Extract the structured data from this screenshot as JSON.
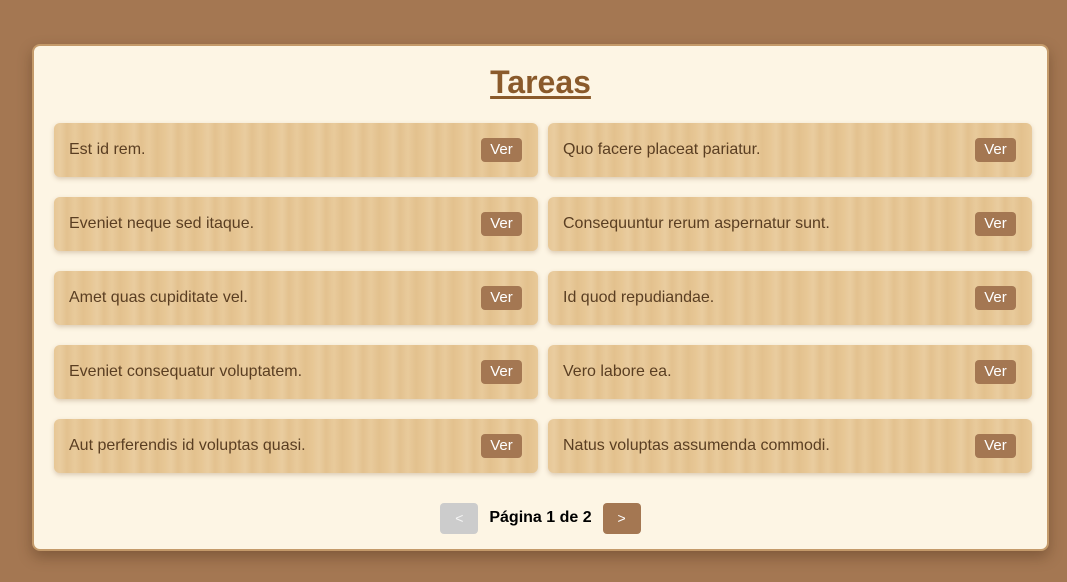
{
  "title": "Tareas",
  "tasks": [
    {
      "text": "Est id rem.",
      "button": "Ver"
    },
    {
      "text": "Quo facere placeat pariatur.",
      "button": "Ver"
    },
    {
      "text": "Eveniet neque sed itaque.",
      "button": "Ver"
    },
    {
      "text": "Consequuntur rerum aspernatur sunt.",
      "button": "Ver"
    },
    {
      "text": "Amet quas cupiditate vel.",
      "button": "Ver"
    },
    {
      "text": "Id quod repudiandae.",
      "button": "Ver"
    },
    {
      "text": "Eveniet consequatur voluptatem.",
      "button": "Ver"
    },
    {
      "text": "Vero labore ea.",
      "button": "Ver"
    },
    {
      "text": "Aut perferendis id voluptas quasi.",
      "button": "Ver"
    },
    {
      "text": "Natus voluptas assumenda commodi.",
      "button": "Ver"
    }
  ],
  "pagination": {
    "prev_label": "<",
    "next_label": ">",
    "page_info": "Página 1 de 2",
    "current_page": 1,
    "total_pages": 2,
    "prev_disabled": true
  },
  "colors": {
    "background": "#a47752",
    "panel": "#fdf5e4",
    "card": "#e7c795",
    "button": "#a47752",
    "title": "#8a5a2b",
    "disabled": "#cccccc"
  }
}
